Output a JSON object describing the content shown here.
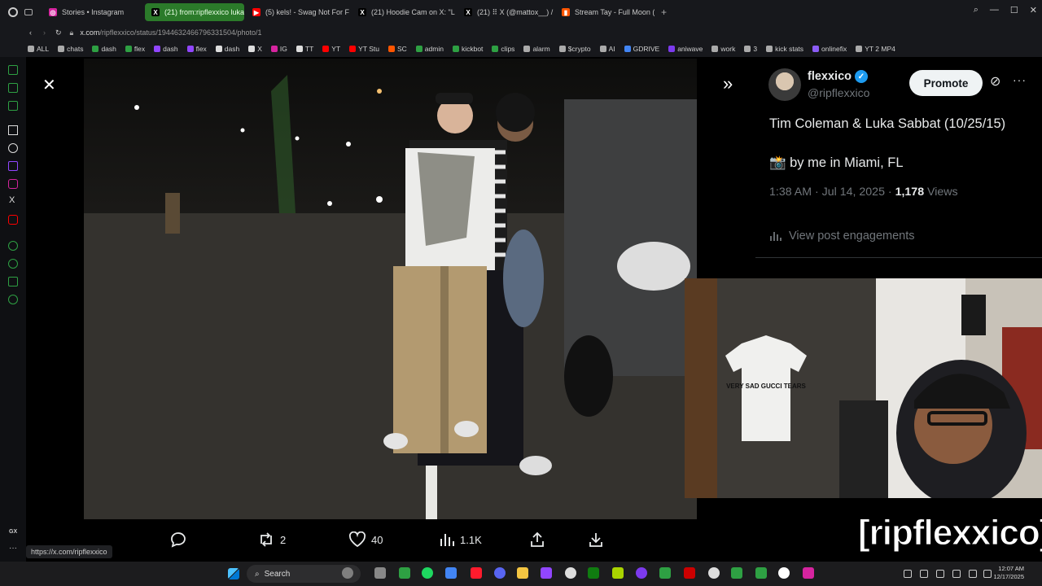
{
  "tabs": [
    {
      "label": "Stories • Instagram",
      "color": "#d6249f",
      "glyph": "◎"
    },
    {
      "label": "(21) from:ripflexxico luka",
      "color": "#000000",
      "glyph": "X",
      "active": true
    },
    {
      "label": "(5) kels! - Swag Not For F",
      "color": "#ff0000",
      "glyph": "▶"
    },
    {
      "label": "(21) Hoodie Cam on X: \"L",
      "color": "#000000",
      "glyph": "X"
    },
    {
      "label": "(21) ⠿ X (@mattox__) / X",
      "color": "#000000",
      "glyph": "X"
    },
    {
      "label": "Stream Tay - Full Moon (f",
      "color": "#ff5500",
      "glyph": "▮"
    }
  ],
  "address": {
    "host": "x.com",
    "path": "/ripflexxico/status/1944632466796331504/photo/1"
  },
  "bookmarks": [
    "ALL",
    "chats",
    "dash",
    "flex",
    "dash",
    "flex",
    "dash",
    "X",
    "IG",
    "TT",
    "YT",
    "YT Stu",
    "SC",
    "admin",
    "kickbot",
    "clips",
    "alarm",
    "$crypto",
    "AI",
    "GDRIVE",
    "aniwave",
    "work",
    "3",
    "kick stats",
    "onlinefix",
    "YT 2 MP4"
  ],
  "viewer": {
    "actions": {
      "reply": "",
      "reposts": "2",
      "likes": "40",
      "views": "1.1K"
    },
    "status_url": "https://x.com/ripflexxico"
  },
  "post": {
    "display_name": "flexxico",
    "handle": "@ripflexxico",
    "promote_label": "Promote",
    "text_line1": "Tim Coleman & Luka Sabbat (10/25/15)",
    "text_line2": "📸 by me in Miami, FL",
    "timestamp": "1:38 AM · Jul 14, 2025 · ",
    "views_count": "1,178",
    "views_label": " Views",
    "engagements_label": "View post engagements"
  },
  "stream_overlay": "[ripflexxico]",
  "shirt_text": "VERY SAD GUCCI TEARS",
  "taskbar": {
    "search_label": "Search",
    "time": "12:07 AM",
    "date": "12/17/2025"
  }
}
